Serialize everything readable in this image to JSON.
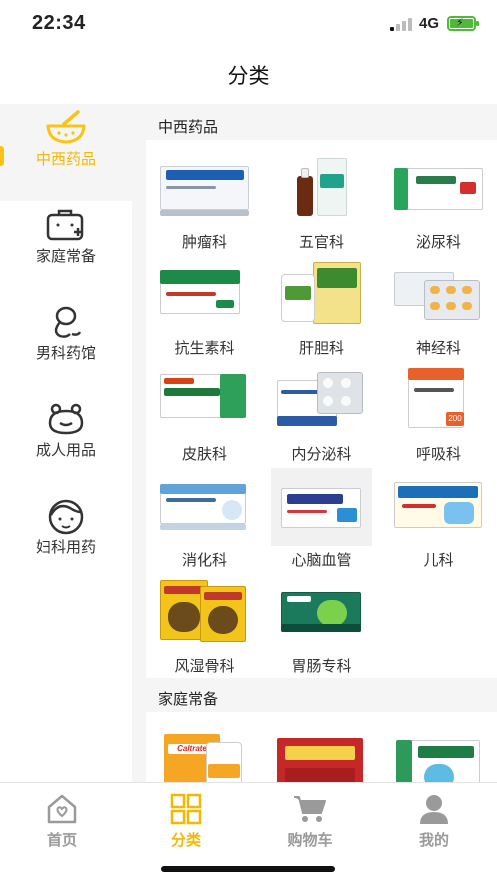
{
  "status": {
    "time": "22:34",
    "network": "4G"
  },
  "nav": {
    "title": "分类"
  },
  "sidebar": {
    "items": [
      {
        "label": "中西药品",
        "icon": "mortar-pestle-icon",
        "active": true
      },
      {
        "label": "家庭常备",
        "icon": "medical-kit-icon",
        "active": false
      },
      {
        "label": "男科药馆",
        "icon": "male-symbol-icon",
        "active": false
      },
      {
        "label": "成人用品",
        "icon": "adult-products-icon",
        "active": false
      },
      {
        "label": "妇科用药",
        "icon": "woman-face-icon",
        "active": false
      }
    ]
  },
  "sections": [
    {
      "title": "中西药品",
      "items": [
        {
          "label": "肿瘤科",
          "product": "吉非替尼片"
        },
        {
          "label": "五官科",
          "product": "滴耳剂"
        },
        {
          "label": "泌尿科",
          "product": "前列安栓"
        },
        {
          "label": "抗生素科",
          "product": "阿莫西林胶囊"
        },
        {
          "label": "肝胆科",
          "product": "肝舒胶囊"
        },
        {
          "label": "神经科",
          "product": "胶囊"
        },
        {
          "label": "皮肤科",
          "product": "盐酸伐昔洛韦片"
        },
        {
          "label": "内分泌科",
          "product": "格列齐特片"
        },
        {
          "label": "呼吸科",
          "product": "200"
        },
        {
          "label": "消化科",
          "product": "奥美拉唑肠溶胶囊"
        },
        {
          "label": "心脑血管",
          "product": "脑心通胶囊"
        },
        {
          "label": "儿科",
          "product": "小儿肺热咳喘口服液"
        },
        {
          "label": "风湿骨科",
          "product": "麝香壮骨膏"
        },
        {
          "label": "胃肠专科",
          "product": "肠炎宁片"
        }
      ]
    },
    {
      "title": "家庭常备",
      "items": [
        {
          "label": "",
          "product": "Caltrate"
        },
        {
          "label": "",
          "product": "舒筋健腰丸"
        },
        {
          "label": "",
          "product": "感冒灵颗粒"
        }
      ]
    }
  ],
  "tabbar": {
    "tabs": [
      {
        "label": "首页",
        "icon": "home-icon",
        "active": false
      },
      {
        "label": "分类",
        "icon": "category-grid-icon",
        "active": true
      },
      {
        "label": "购物车",
        "icon": "cart-icon",
        "active": false
      },
      {
        "label": "我的",
        "icon": "profile-icon",
        "active": false
      }
    ]
  },
  "colors": {
    "accent": "#f9c414",
    "accent_text": "#f5b800",
    "inactive": "#9a9a9a",
    "content_bg": "#f5f5f5"
  }
}
